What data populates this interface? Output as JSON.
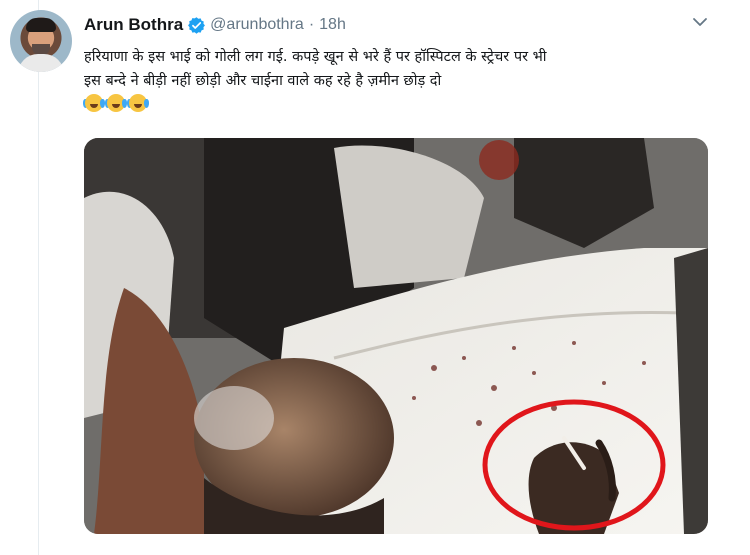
{
  "tweet": {
    "author_name": "Arun Bothra",
    "handle": "@arunbothra",
    "separator": "·",
    "timestamp": "18h",
    "text_lines": [
      "हरियाणा के इस भाई को गोली लग गई. कपड़े खून से भरे हैं पर हॉस्पिटल के स्ट्रेचर पर भी",
      "इस बन्दे ने बीड़ी नहीं छोड़ी और चाईना वाले कह रहे है ज़मीन छोड़ दो"
    ],
    "emojis": [
      "face-with-tears-of-joy",
      "face-with-tears-of-joy",
      "face-with-tears-of-joy"
    ]
  },
  "icons": {
    "verified": "verified-badge-icon",
    "more": "chevron-down-icon"
  },
  "colors": {
    "verified_blue": "#1da1f2",
    "annotation_red": "#e0161b",
    "secondary_text": "#657786",
    "primary_text": "#14171a"
  }
}
